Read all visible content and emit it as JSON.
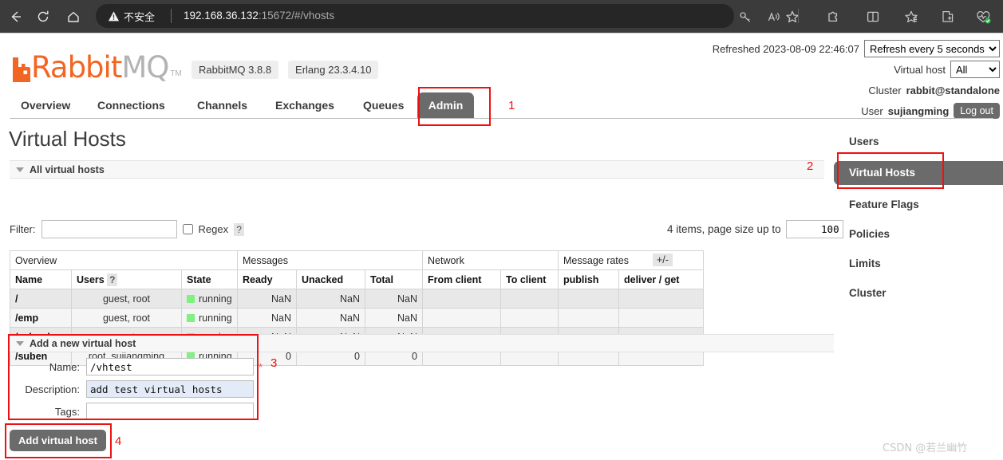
{
  "browser": {
    "back_icon": "back-arrow-icon",
    "reload_icon": "reload-icon",
    "home_icon": "home-icon",
    "security_icon": "warning-triangle-icon",
    "security_label": "不安全",
    "url_host": "192.168.36.132",
    "url_rest": ":15672/#/vhosts",
    "tools": [
      {
        "name": "key-icon"
      },
      {
        "name": "read-aloud-icon"
      },
      {
        "name": "favorite-star-icon"
      },
      {
        "name": "extensions-puzzle-icon"
      },
      {
        "name": "split-screen-icon"
      },
      {
        "name": "collections-icon"
      },
      {
        "name": "add-tab-icon"
      },
      {
        "name": "browser-essentials-icon"
      }
    ]
  },
  "brand": {
    "logo_rabbit": "Rabbit",
    "logo_mq": "MQ",
    "logo_tm": "TM",
    "rabbitmq_version": "RabbitMQ 3.8.8",
    "erlang_version": "Erlang 23.3.4.10",
    "accent_color": "#f26522"
  },
  "header": {
    "refreshed_label": "Refreshed 2023-08-09 22:46:07",
    "refresh_select": "Refresh every 5 seconds",
    "refresh_options": [
      "Refresh every 5 seconds"
    ],
    "vhost_label": "Virtual host",
    "vhost_select": "All",
    "vhost_options": [
      "All"
    ],
    "cluster_label": "Cluster",
    "cluster_name": "rabbit@standalone",
    "user_label": "User",
    "user_name": "sujiangming",
    "logout_label": "Log out"
  },
  "nav": {
    "tabs": [
      {
        "label": "Overview",
        "active": false
      },
      {
        "label": "Connections",
        "active": false
      },
      {
        "label": "Channels",
        "active": false
      },
      {
        "label": "Exchanges",
        "active": false
      },
      {
        "label": "Queues",
        "active": false
      },
      {
        "label": "Admin",
        "active": true
      }
    ]
  },
  "main": {
    "page_title": "Virtual Hosts",
    "all_vhosts_section": "All virtual hosts",
    "filter_label": "Filter:",
    "filter_value": "",
    "regex_label": "Regex",
    "help_mark": "?",
    "pagesize_label": "4 items, page size up to",
    "pagesize_value": "100",
    "plus_minus": "+/-"
  },
  "table": {
    "group_headers": [
      {
        "label": "Overview",
        "span": 3
      },
      {
        "label": "Messages",
        "span": 3
      },
      {
        "label": "Network",
        "span": 2
      },
      {
        "label": "Message rates",
        "span": 2
      }
    ],
    "columns": [
      "Name",
      "Users",
      "State",
      "Ready",
      "Unacked",
      "Total",
      "From client",
      "To client",
      "publish",
      "deliver / get"
    ],
    "users_help": "?",
    "rows": [
      {
        "name": "/",
        "users": "guest, root",
        "state": "running",
        "ready": "NaN",
        "unacked": "NaN",
        "total": "NaN",
        "from_client": "",
        "to_client": "",
        "publish": "",
        "deliver_get": ""
      },
      {
        "name": "/emp",
        "users": "guest, root",
        "state": "running",
        "ready": "NaN",
        "unacked": "NaN",
        "total": "NaN",
        "from_client": "",
        "to_client": "",
        "publish": "",
        "deliver_get": ""
      },
      {
        "name": "/school",
        "users": "root",
        "state": "running",
        "ready": "NaN",
        "unacked": "NaN",
        "total": "NaN",
        "from_client": "",
        "to_client": "",
        "publish": "",
        "deliver_get": ""
      },
      {
        "name": "/suben",
        "users": "root, sujiangming",
        "state": "running",
        "ready": "0",
        "unacked": "0",
        "total": "0",
        "from_client": "",
        "to_client": "",
        "publish": "",
        "deliver_get": ""
      }
    ]
  },
  "add_form": {
    "section_title": "Add a new virtual host",
    "name_label": "Name:",
    "name_value": "/vhtest",
    "required_mark": "*",
    "description_label": "Description:",
    "description_value": "add test virtual hosts",
    "tags_label": "Tags:",
    "tags_value": "",
    "submit_label": "Add virtual host"
  },
  "side_menu": {
    "items": [
      {
        "label": "Users",
        "active": false
      },
      {
        "label": "Virtual Hosts",
        "active": true
      },
      {
        "label": "Feature Flags",
        "active": false
      },
      {
        "label": "Policies",
        "active": false
      },
      {
        "label": "Limits",
        "active": false
      },
      {
        "label": "Cluster",
        "active": false
      }
    ]
  },
  "annotations": {
    "one": "1",
    "two": "2",
    "three": "3",
    "four": "4",
    "color": "#ee1111"
  },
  "watermark": "CSDN @若兰幽竹"
}
